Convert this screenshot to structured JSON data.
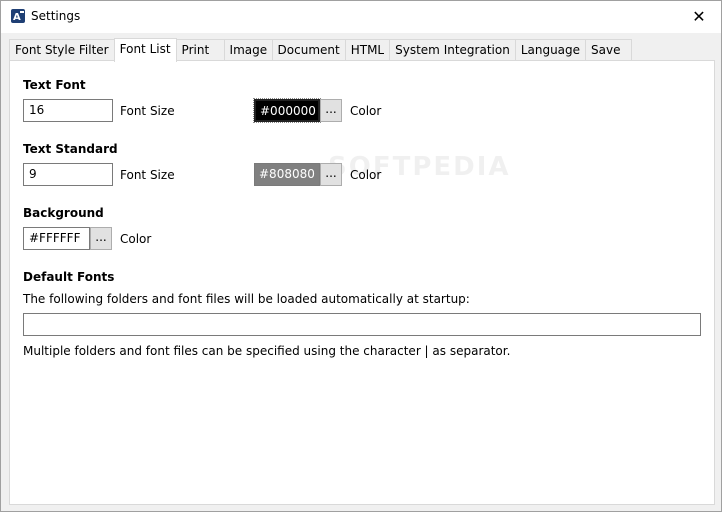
{
  "window": {
    "title": "Settings",
    "close_glyph": "✕"
  },
  "tabs": [
    {
      "label": "Font Style Filter",
      "active": false
    },
    {
      "label": "Font List",
      "active": true
    },
    {
      "label": "Print",
      "active": false
    },
    {
      "label": "Image",
      "active": false
    },
    {
      "label": "Document",
      "active": false
    },
    {
      "label": "HTML",
      "active": false
    },
    {
      "label": "System Integration",
      "active": false
    },
    {
      "label": "Language",
      "active": false
    },
    {
      "label": "Save",
      "active": false
    }
  ],
  "text_font": {
    "title": "Text Font",
    "size_value": "16",
    "size_label": "Font Size",
    "color_value": "#000000",
    "color_button": "...",
    "color_label": "Color"
  },
  "text_standard": {
    "title": "Text Standard",
    "size_value": "9",
    "size_label": "Font Size",
    "color_value": "#808080",
    "color_button": "...",
    "color_label": "Color"
  },
  "background": {
    "title": "Background",
    "color_value": "#FFFFFF",
    "color_button": "...",
    "color_label": "Color"
  },
  "default_fonts": {
    "title": "Default Fonts",
    "description": "The following folders and font files will be loaded automatically at startup:",
    "path_value": "",
    "hint": "Multiple folders and font files can be specified using the character | as separator."
  },
  "watermark": "SOFTPEDIA"
}
